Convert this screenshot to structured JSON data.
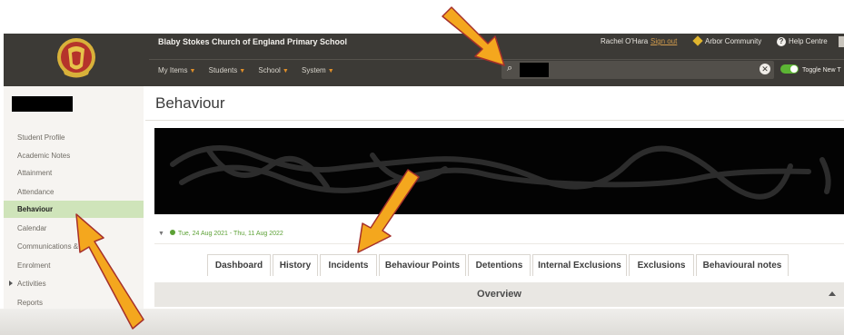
{
  "header": {
    "school_name": "Blaby Stokes Church of England Primary School",
    "user_name": "Rachel O'Hara",
    "sign_out": "Sign out",
    "community": "Arbor Community",
    "help": "Help Centre",
    "nav": [
      {
        "label": "My Items"
      },
      {
        "label": "Students"
      },
      {
        "label": "School"
      },
      {
        "label": "System"
      }
    ],
    "toggle_label": "Toggle New T",
    "search_value": ""
  },
  "sidebar": {
    "items": [
      {
        "label": "Student Profile"
      },
      {
        "label": "Academic Notes"
      },
      {
        "label": "Attainment"
      },
      {
        "label": "Attendance"
      },
      {
        "label": "Behaviour"
      },
      {
        "label": "Calendar"
      },
      {
        "label": "Communications &"
      },
      {
        "label": "Enrolment"
      },
      {
        "label": "Activities"
      },
      {
        "label": "Reports"
      }
    ],
    "active_index": 4
  },
  "main": {
    "title": "Behaviour",
    "date_range": "Tue, 24 Aug 2021 - Thu, 11 Aug 2022",
    "tabs": [
      {
        "label": "Dashboard"
      },
      {
        "label": "History"
      },
      {
        "label": "Incidents"
      },
      {
        "label": "Behaviour Points"
      },
      {
        "label": "Detentions"
      },
      {
        "label": "Internal Exclusions"
      },
      {
        "label": "Exclusions"
      },
      {
        "label": "Behavioural notes"
      }
    ],
    "active_tab": 0,
    "overview_label": "Overview"
  },
  "colors": {
    "header_bg": "#3c3a36",
    "active_sidebar_bg": "#cfe4ba",
    "accent_green": "#5ca135",
    "arrow_orange": "#f4a71e",
    "arrow_outline": "#a5302b"
  },
  "icons": {
    "logo": "school-crest-logo",
    "search": "search-icon",
    "clear": "clear-icon",
    "help": "help-icon",
    "filter": "filter-icon"
  }
}
